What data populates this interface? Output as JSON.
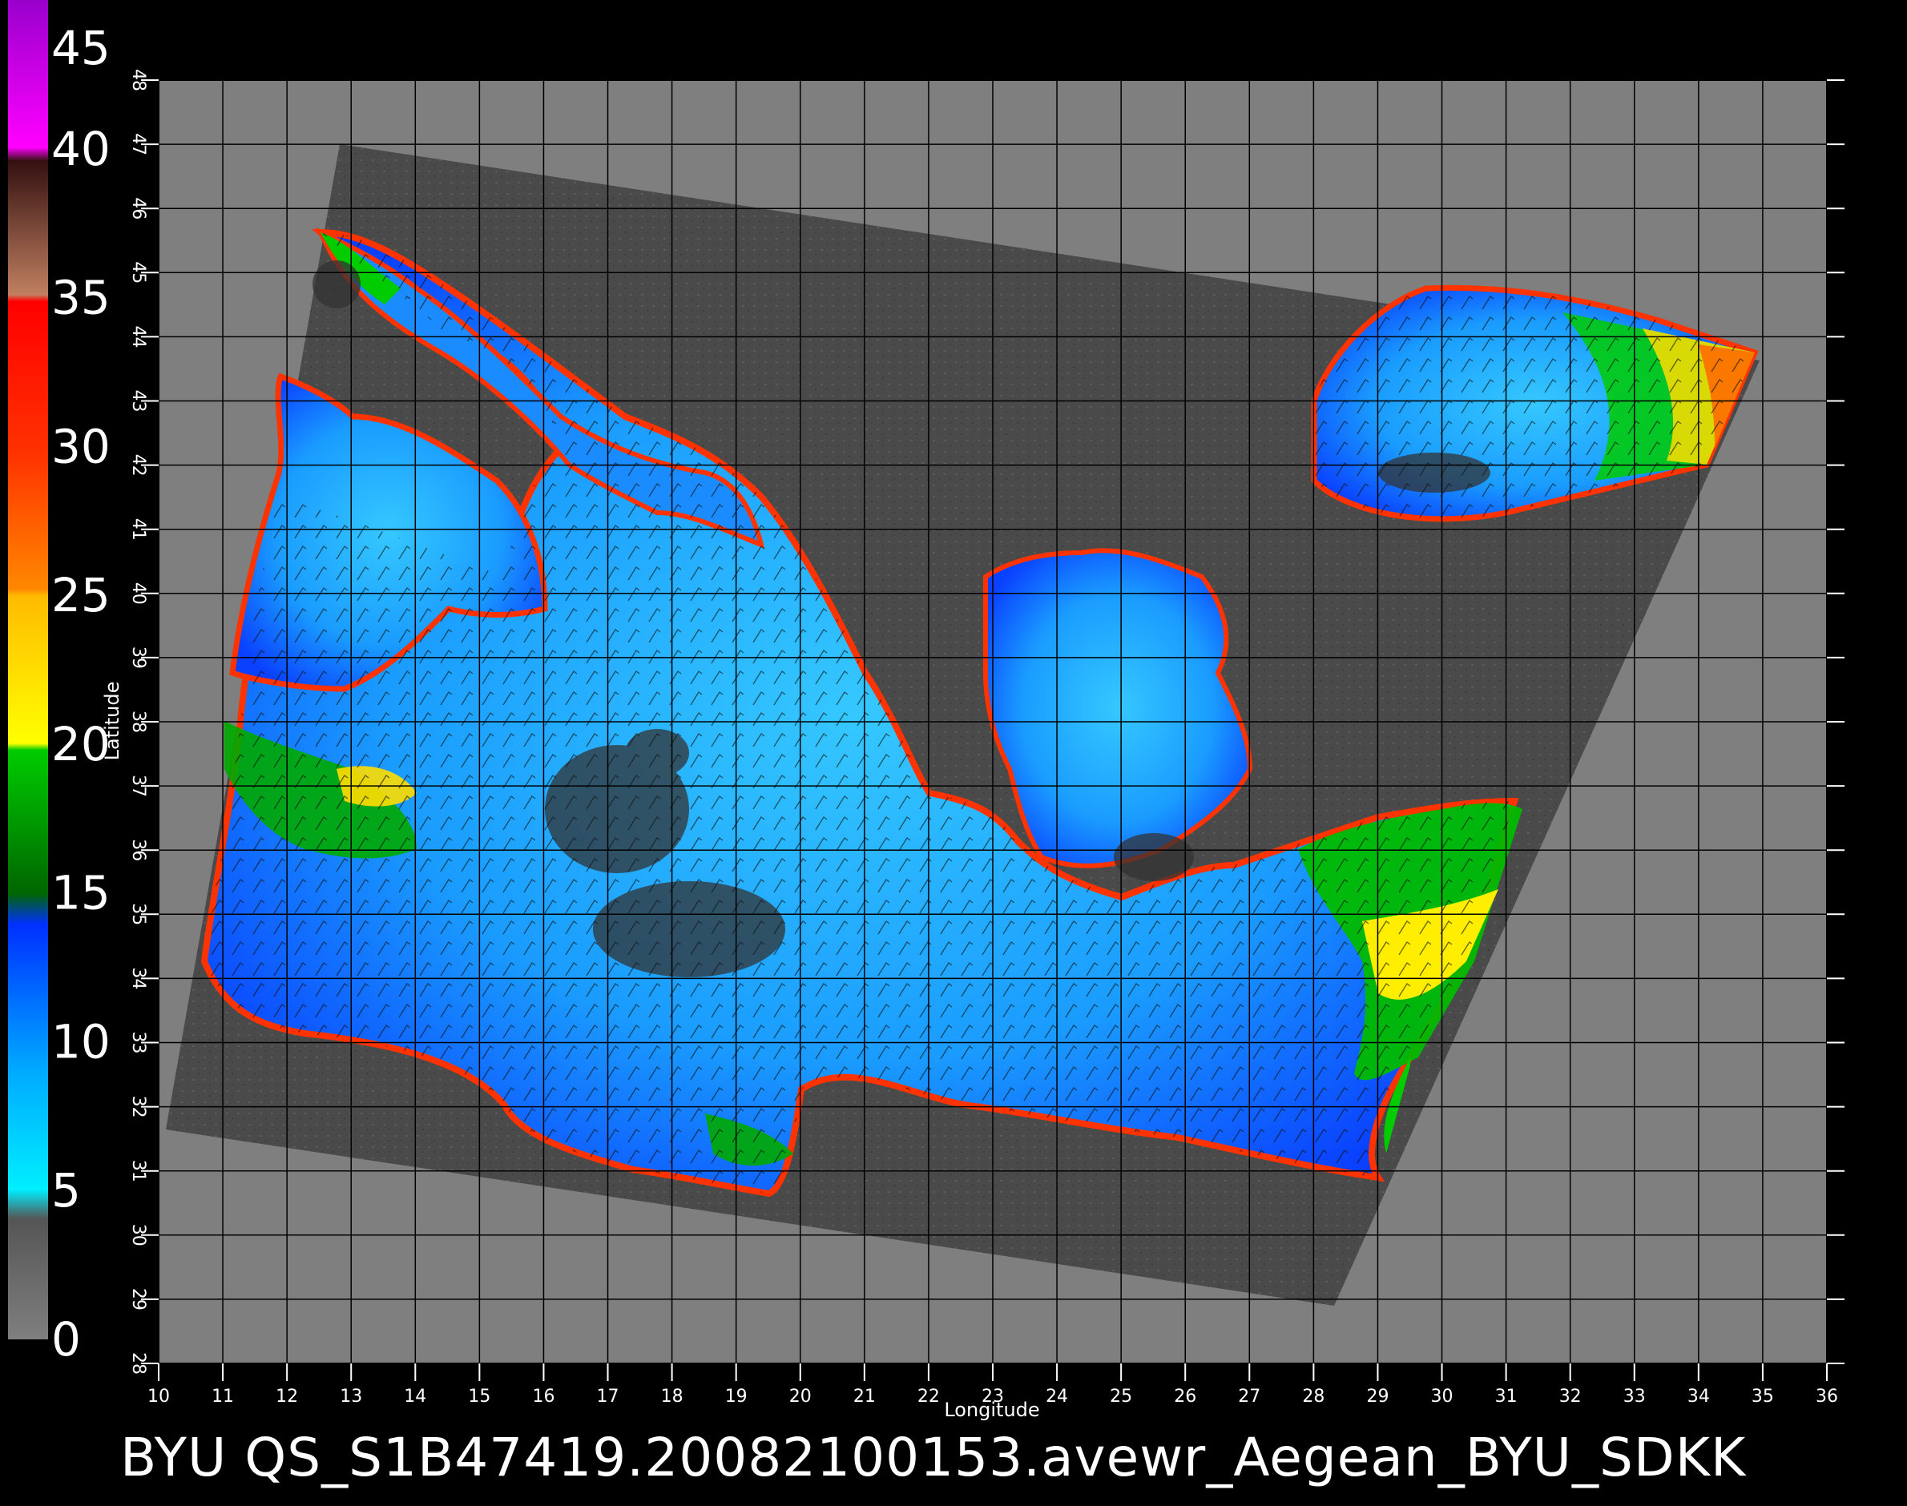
{
  "colors": {
    "background": "#000000",
    "plot_gray": "#7f7f7f",
    "swath_dark": "#4a4a4a",
    "grid": "#000000",
    "colorbar_stops": [
      "#7f7f7f",
      "#555555",
      "#00eeff",
      "#00aaff",
      "#0060ff",
      "#0030ff",
      "#006600",
      "#00cc00",
      "#ffff00",
      "#ffcc00",
      "#ff7700",
      "#ff3300",
      "#ff0000",
      "#cc6633",
      "#552222",
      "#ff00ff",
      "#9900cc"
    ]
  },
  "colorbar": {
    "min": 0,
    "max": 45,
    "labels": [
      "45",
      "40",
      "35",
      "30",
      "25",
      "20",
      "15",
      "10",
      "5",
      "0"
    ]
  },
  "axes": {
    "xlabel": "Longitude",
    "ylabel": "Latitude",
    "x_ticks": [
      "10",
      "11",
      "12",
      "13",
      "14",
      "15",
      "16",
      "17",
      "18",
      "19",
      "20",
      "21",
      "22",
      "23",
      "24",
      "25",
      "26",
      "27",
      "28",
      "29",
      "30",
      "31",
      "32",
      "33",
      "34",
      "35",
      "36"
    ],
    "y_ticks": [
      "48",
      "47",
      "46",
      "45",
      "44",
      "43",
      "42",
      "41",
      "40",
      "39",
      "38",
      "37",
      "36",
      "35",
      "34",
      "33",
      "32",
      "31",
      "30",
      "29",
      "28"
    ],
    "xlim": [
      10,
      36
    ],
    "ylim": [
      28,
      48
    ]
  },
  "caption": "BYU  QS_S1B47419.20082100153.avewr_Aegean_BYU_SDKK"
}
